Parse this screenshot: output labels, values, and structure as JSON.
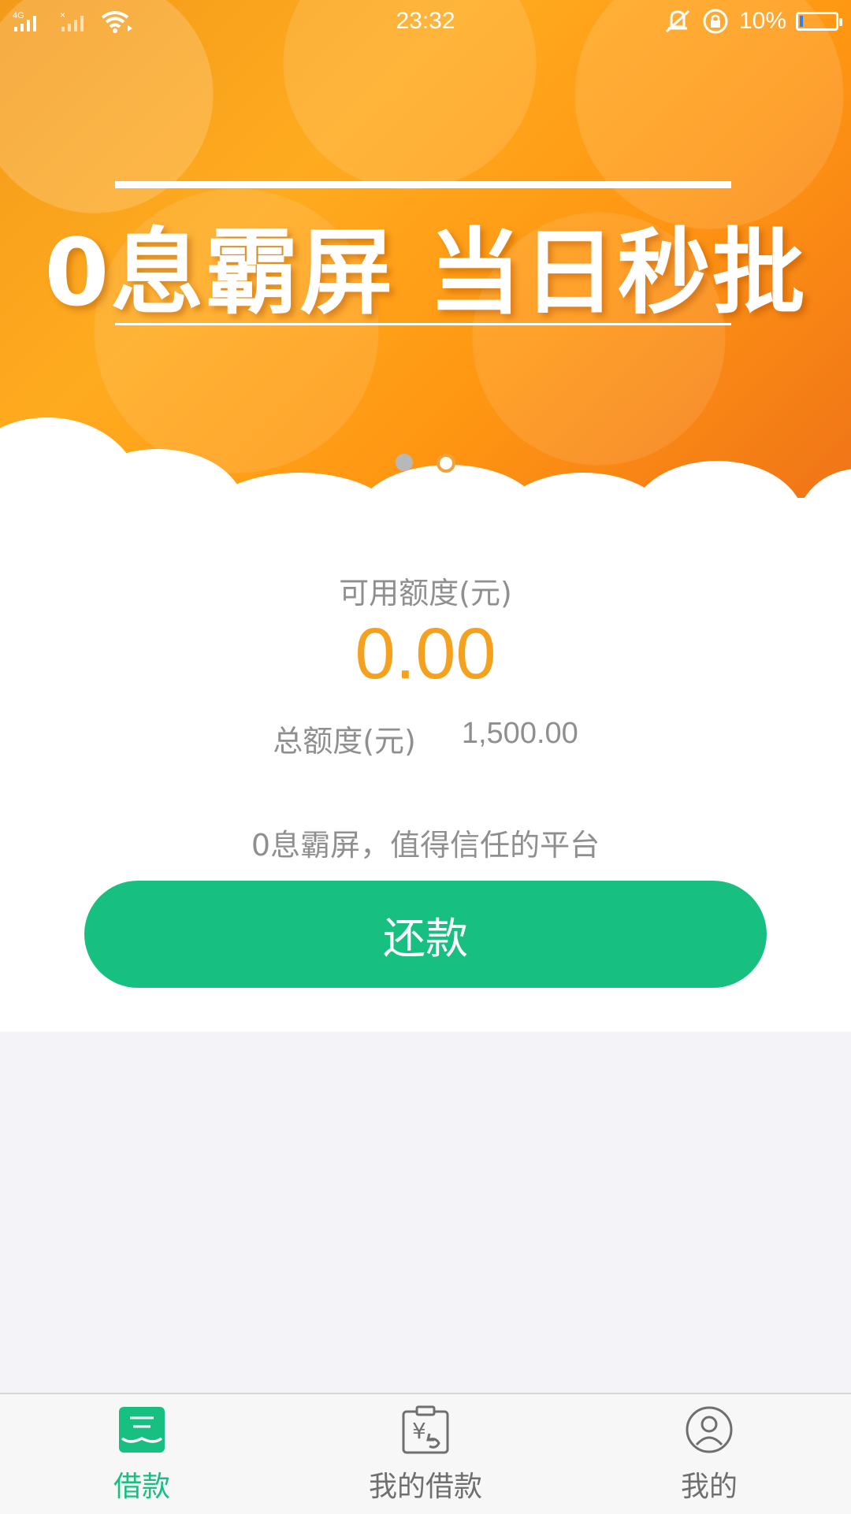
{
  "status_bar": {
    "network_label": "4G",
    "time": "23:32",
    "battery_percent": "10%",
    "battery_level": 0.1
  },
  "banner": {
    "headline": "0息霸屏 当日秒批",
    "slides_total": 2,
    "active_slide": 2
  },
  "credit": {
    "available_label": "可用额度(元)",
    "available_amount": "0.00",
    "total_label": "总额度(元)",
    "total_amount": "1,500.00",
    "slogan": "0息霸屏，值得信任的平台",
    "repay_button_label": "还款"
  },
  "bottom_nav": {
    "items": [
      {
        "label": "借款",
        "icon": "loan-icon",
        "active": true
      },
      {
        "label": "我的借款",
        "icon": "my-loan-icon",
        "active": false
      },
      {
        "label": "我的",
        "icon": "profile-icon",
        "active": false
      }
    ]
  },
  "colors": {
    "accent_green": "#17bf80",
    "amount_orange": "#f5a11e",
    "text_gray": "#8f8f8f"
  }
}
